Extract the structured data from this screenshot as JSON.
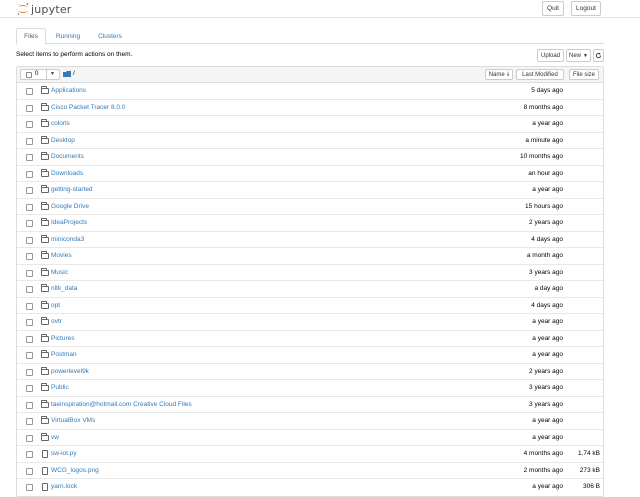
{
  "header": {
    "logo_text": "jupyter",
    "quit_label": "Quit",
    "logout_label": "Logout"
  },
  "tabs": [
    {
      "label": "Files",
      "active": true
    },
    {
      "label": "Running",
      "active": false
    },
    {
      "label": "Clusters",
      "active": false
    }
  ],
  "toolbar": {
    "instructions": "Select items to perform actions on them.",
    "upload_label": "Upload",
    "new_label": "New",
    "refresh_icon": "refresh-icon"
  },
  "list_header": {
    "selected_count": "0",
    "path": "/",
    "name_label": "Name",
    "last_modified_label": "Last Modified",
    "file_size_label": "File size"
  },
  "colors": {
    "link": "#337ab7",
    "jupyter_orange": "#f37726",
    "border": "#dddddd"
  },
  "items": [
    {
      "type": "folder",
      "name": "Applications",
      "modified": "5 days ago",
      "size": ""
    },
    {
      "type": "folder",
      "name": "Cisco Packet Tracer 8.0.0",
      "modified": "8 months ago",
      "size": ""
    },
    {
      "type": "folder",
      "name": "colorls",
      "modified": "a year ago",
      "size": ""
    },
    {
      "type": "folder",
      "name": "Desktop",
      "modified": "a minute ago",
      "size": ""
    },
    {
      "type": "folder",
      "name": "Documents",
      "modified": "10 months ago",
      "size": ""
    },
    {
      "type": "folder",
      "name": "Downloads",
      "modified": "an hour ago",
      "size": ""
    },
    {
      "type": "folder",
      "name": "getting-started",
      "modified": "a year ago",
      "size": ""
    },
    {
      "type": "folder",
      "name": "Google Drive",
      "modified": "15 hours ago",
      "size": ""
    },
    {
      "type": "folder",
      "name": "IdeaProjects",
      "modified": "2 years ago",
      "size": ""
    },
    {
      "type": "folder",
      "name": "miniconda3",
      "modified": "4 days ago",
      "size": ""
    },
    {
      "type": "folder",
      "name": "Movies",
      "modified": "a month ago",
      "size": ""
    },
    {
      "type": "folder",
      "name": "Music",
      "modified": "3 years ago",
      "size": ""
    },
    {
      "type": "folder",
      "name": "nltk_data",
      "modified": "a day ago",
      "size": ""
    },
    {
      "type": "folder",
      "name": "opt",
      "modified": "4 days ago",
      "size": ""
    },
    {
      "type": "folder",
      "name": "ovtr",
      "modified": "a year ago",
      "size": ""
    },
    {
      "type": "folder",
      "name": "Pictures",
      "modified": "a year ago",
      "size": ""
    },
    {
      "type": "folder",
      "name": "Postman",
      "modified": "a year ago",
      "size": ""
    },
    {
      "type": "folder",
      "name": "powerlevel9k",
      "modified": "2 years ago",
      "size": ""
    },
    {
      "type": "folder",
      "name": "Public",
      "modified": "3 years ago",
      "size": ""
    },
    {
      "type": "folder",
      "name": "taeinspiration@hotmail.com Creative Cloud Files",
      "modified": "3 years ago",
      "size": ""
    },
    {
      "type": "folder",
      "name": "VirtualBox VMs",
      "modified": "a year ago",
      "size": ""
    },
    {
      "type": "folder",
      "name": "vw",
      "modified": "a year ago",
      "size": ""
    },
    {
      "type": "file",
      "name": "sw-iot.py",
      "modified": "4 months ago",
      "size": "1.74 kB"
    },
    {
      "type": "file",
      "name": "WCG_logos.png",
      "modified": "2 months ago",
      "size": "273 kB"
    },
    {
      "type": "file",
      "name": "yarn.lock",
      "modified": "a year ago",
      "size": "306 B"
    }
  ]
}
